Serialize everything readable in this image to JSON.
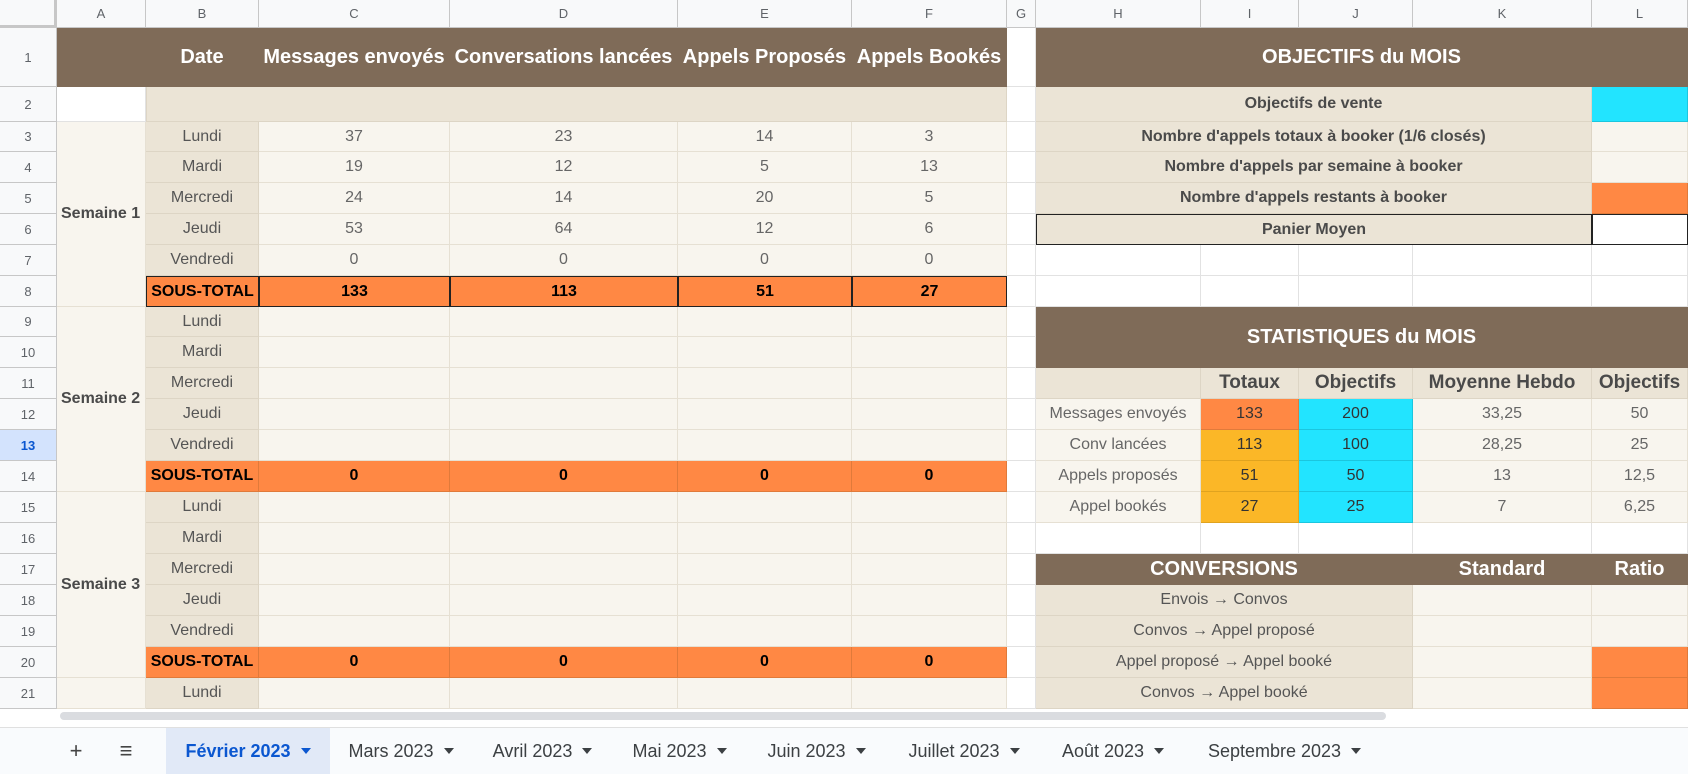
{
  "columns": [
    "A",
    "B",
    "C",
    "D",
    "E",
    "F",
    "G",
    "H",
    "I",
    "J",
    "K",
    "L"
  ],
  "rows": [
    "1",
    "2",
    "3",
    "4",
    "5",
    "6",
    "7",
    "8",
    "9",
    "10",
    "11",
    "12",
    "13",
    "14",
    "15",
    "16",
    "17",
    "18",
    "19",
    "20",
    "21"
  ],
  "selected_row": "13",
  "main_table": {
    "headers": [
      "Date",
      "Messages envoyés",
      "Conversations lancées",
      "Appels Proposés",
      "Appels Bookés"
    ],
    "week_labels": [
      "Semaine 1",
      "Semaine 2",
      "Semaine 3"
    ],
    "days": [
      "Lundi",
      "Mardi",
      "Mercredi",
      "Jeudi",
      "Vendredi"
    ],
    "week1_values": [
      [
        "37",
        "23",
        "14",
        "3"
      ],
      [
        "19",
        "12",
        "5",
        "13"
      ],
      [
        "24",
        "14",
        "20",
        "5"
      ],
      [
        "53",
        "64",
        "12",
        "6"
      ],
      [
        "0",
        "0",
        "0",
        "0"
      ]
    ],
    "subtotal_label": "SOUS-TOTAL",
    "subtotals": [
      [
        "133",
        "113",
        "51",
        "27"
      ],
      [
        "0",
        "0",
        "0",
        "0"
      ],
      [
        "0",
        "0",
        "0",
        "0"
      ]
    ],
    "row21_day": "Lundi"
  },
  "objectifs": {
    "title": "OBJECTIFS du MOIS",
    "items": [
      "Objectifs de vente",
      "Nombre d'appels totaux à booker (1/6 closés)",
      "Nombre d'appels par semaine à booker",
      "Nombre d'appels restants à booker",
      "Panier Moyen"
    ]
  },
  "statistiques": {
    "title": "STATISTIQUES du MOIS",
    "headers": [
      "Totaux",
      "Objectifs",
      "Moyenne Hebdo",
      "Objectifs"
    ],
    "rows": [
      {
        "label": "Messages envoyés",
        "totaux": "133",
        "objectifs": "200",
        "moyenne": "33,25",
        "objectifs_hebdo": "50"
      },
      {
        "label": "Conv lancées",
        "totaux": "113",
        "objectifs": "100",
        "moyenne": "28,25",
        "objectifs_hebdo": "25"
      },
      {
        "label": "Appels proposés",
        "totaux": "51",
        "objectifs": "50",
        "moyenne": "13",
        "objectifs_hebdo": "12,5"
      },
      {
        "label": "Appel bookés",
        "totaux": "27",
        "objectifs": "25",
        "moyenne": "7",
        "objectifs_hebdo": "6,25"
      }
    ]
  },
  "conversions": {
    "title": "CONVERSIONS",
    "standard": "Standard",
    "ratio": "Ratio",
    "items": [
      "Envois → Convos",
      "Convos → Appel proposé",
      "Appel proposé → Appel booké",
      "Convos → Appel booké"
    ]
  },
  "colors": {
    "brown": "#7f6b58",
    "beige": "#ebe4d6",
    "cream": "#f8f5ee",
    "orange": "#ff8844",
    "cyan": "#22e4ff",
    "yellow": "#fbb727"
  },
  "tabbar": {
    "add_icon": "+",
    "menu_icon": "≡",
    "tabs": [
      "Février 2023",
      "Mars 2023",
      "Avril 2023",
      "Mai 2023",
      "Juin 2023",
      "Juillet 2023",
      "Août 2023",
      "Septembre 2023"
    ],
    "active_index": 0
  }
}
